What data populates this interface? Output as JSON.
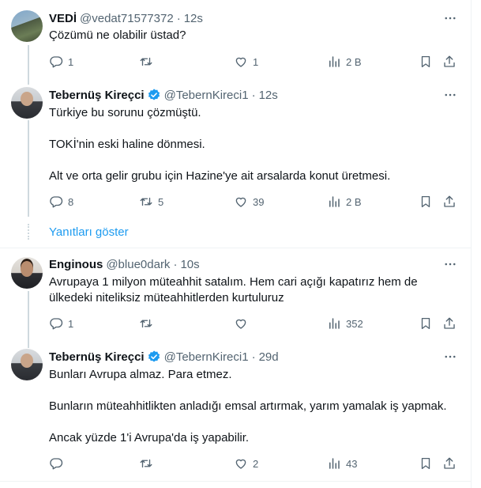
{
  "tweets": [
    {
      "name": "VEDİ",
      "handle": "@vedat71577372",
      "time": "12s",
      "verified": false,
      "lines": [
        "Çözümü ne olabilir üstad?"
      ],
      "replies": "1",
      "retweets": "",
      "likes": "1",
      "views": "2 B"
    },
    {
      "name": "Tebernüş Kireçci",
      "handle": "@TebernKireci1",
      "time": "12s",
      "verified": true,
      "lines": [
        "Türkiye bu sorunu çözmüştü.",
        "TOKİ'nin eski haline dönmesi.",
        "Alt ve orta gelir grubu için Hazine'ye ait arsalarda konut üretmesi."
      ],
      "replies": "8",
      "retweets": "5",
      "likes": "39",
      "views": "2 B"
    },
    {
      "name": "Enginous",
      "handle": "@blue0dark",
      "time": "10s",
      "verified": false,
      "lines": [
        "Avrupaya 1 milyon müteahhit satalım. Hem cari açığı kapatırız hem de",
        "ülkedeki niteliksiz müteahhitlerden  kurtuluruz"
      ],
      "replies": "1",
      "retweets": "",
      "likes": "",
      "views": "352"
    },
    {
      "name": "Tebernüş Kireçci",
      "handle": "@TebernKireci1",
      "time": "29d",
      "verified": true,
      "lines": [
        "Bunları Avrupa almaz. Para etmez.",
        "Bunların müteahhitlikten anladığı emsal artırmak, yarım yamalak iş yapmak.",
        "Ancak yüzde 1'i Avrupa'da iş yapabilir."
      ],
      "replies": "",
      "retweets": "",
      "likes": "2",
      "views": "43"
    }
  ],
  "show_replies": "Yanıtları göster",
  "colors": {
    "accent": "#1d9bf0",
    "muted": "#536471",
    "text": "#0f1419",
    "border": "#eff3f4"
  },
  "icons": [
    "reply-icon",
    "retweet-icon",
    "like-icon",
    "views-icon",
    "bookmark-icon",
    "share-icon",
    "more-icon",
    "verified-icon"
  ]
}
